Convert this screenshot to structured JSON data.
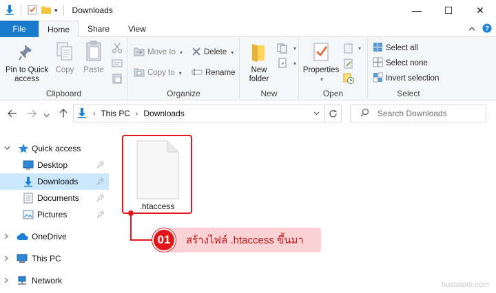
{
  "window": {
    "title": "Downloads",
    "minimize": "—",
    "maximize": "☐",
    "close": "✕"
  },
  "tabs": [
    {
      "label": "File"
    },
    {
      "label": "Home"
    },
    {
      "label": "Share"
    },
    {
      "label": "View"
    }
  ],
  "ribbon": {
    "clipboard": {
      "label": "Clipboard",
      "pin": "Pin to Quick access",
      "copy": "Copy",
      "paste": "Paste"
    },
    "organize": {
      "label": "Organize",
      "move_to": "Move to",
      "copy_to": "Copy to",
      "delete": "Delete",
      "rename": "Rename"
    },
    "new": {
      "label": "New",
      "new_folder": "New folder"
    },
    "open": {
      "label": "Open",
      "properties": "Properties"
    },
    "select": {
      "label": "Select",
      "select_all": "Select all",
      "select_none": "Select none",
      "invert": "Invert selection"
    }
  },
  "address": {
    "crumbs": [
      "This PC",
      "Downloads"
    ],
    "search_placeholder": "Search Downloads"
  },
  "nav": {
    "quick_access": "Quick access",
    "desktop": "Desktop",
    "downloads": "Downloads",
    "documents": "Documents",
    "pictures": "Pictures",
    "onedrive": "OneDrive",
    "this_pc": "This PC",
    "network": "Network"
  },
  "content": {
    "file_name": ".htaccess"
  },
  "annotation": {
    "step": "01",
    "text": "สร้างไฟล์ .htaccess ขึ้นมา",
    "color": "#e0161b"
  },
  "watermark": "hostatom.com"
}
